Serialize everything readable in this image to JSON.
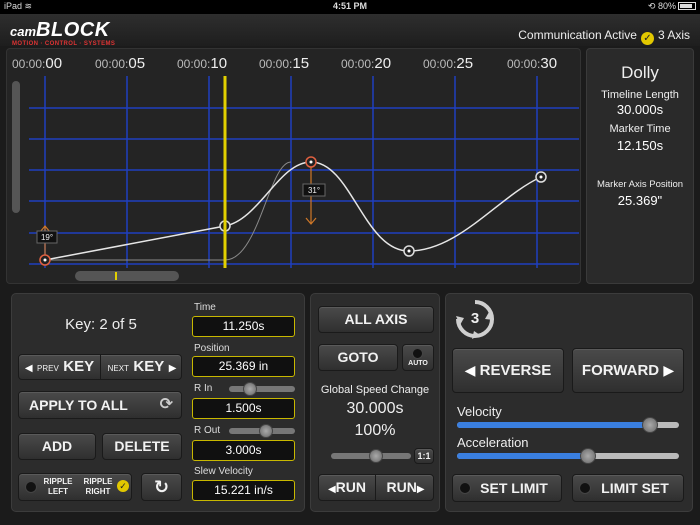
{
  "status_bar": {
    "device": "iPad",
    "time": "4:51 PM",
    "battery": "80%"
  },
  "header": {
    "logo_cam": "cam",
    "logo_block": "BLOCK",
    "logo_tagline": "MOTION · CONTROL · SYSTEMS",
    "communication": "Communication Active",
    "axis_count": "3 Axis"
  },
  "timeline": {
    "ticks": [
      {
        "prefix": "00:00:",
        "value": "00"
      },
      {
        "prefix": "00:00:",
        "value": "05"
      },
      {
        "prefix": "00:00:",
        "value": "10"
      },
      {
        "prefix": "00:00:",
        "value": "15"
      },
      {
        "prefix": "00:00:",
        "value": "20"
      },
      {
        "prefix": "00:00:",
        "value": "25"
      },
      {
        "prefix": "00:00:",
        "value": "30"
      }
    ],
    "angle_labels": [
      "19°",
      "31°"
    ]
  },
  "info": {
    "axis_name": "Dolly",
    "timeline_length_label": "Timeline Length",
    "timeline_length": "30.000s",
    "marker_time_label": "Marker Time",
    "marker_time": "12.150s",
    "marker_position_label": "Marker Axis Position",
    "marker_position": "25.369\""
  },
  "key_panel": {
    "key_counter": "Key: 2 of 5",
    "prev_small": "PREV",
    "prev_big": "KEY",
    "next_small": "NEXT",
    "next_big": "KEY",
    "apply_all": "APPLY TO ALL",
    "add": "ADD",
    "delete": "DELETE",
    "ripple_left_1": "RIPPLE",
    "ripple_left_2": "LEFT",
    "ripple_right_1": "RIPPLE",
    "ripple_right_2": "RIGHT",
    "time_label": "Time",
    "time_value": "11.250s",
    "position_label": "Position",
    "position_value": "25.369 in",
    "r_in_label": "R In",
    "r_in_value": "1.500s",
    "r_out_label": "R Out",
    "r_out_value": "3.000s",
    "slew_label": "Slew Velocity",
    "slew_value": "15.221 in/s"
  },
  "run_panel": {
    "all_axis": "ALL AXIS",
    "goto": "GOTO",
    "auto": "AUTO",
    "global_label": "Global Speed Change",
    "global_time": "30.000s",
    "global_percent": "100%",
    "ratio": "1:1",
    "run_back": "RUN",
    "run_fwd": "RUN"
  },
  "motion_panel": {
    "axis_number": "3",
    "reverse": "REVERSE",
    "forward": "FORWARD",
    "velocity_label": "Velocity",
    "acceleration_label": "Acceleration",
    "set_limit": "SET LIMIT",
    "limit_set": "LIMIT SET",
    "velocity_level": 0.87,
    "acceleration_level": 0.59
  },
  "colors": {
    "accent": "#e2d000",
    "grid": "#1f3fbf",
    "curve": "#e6e6e6"
  }
}
